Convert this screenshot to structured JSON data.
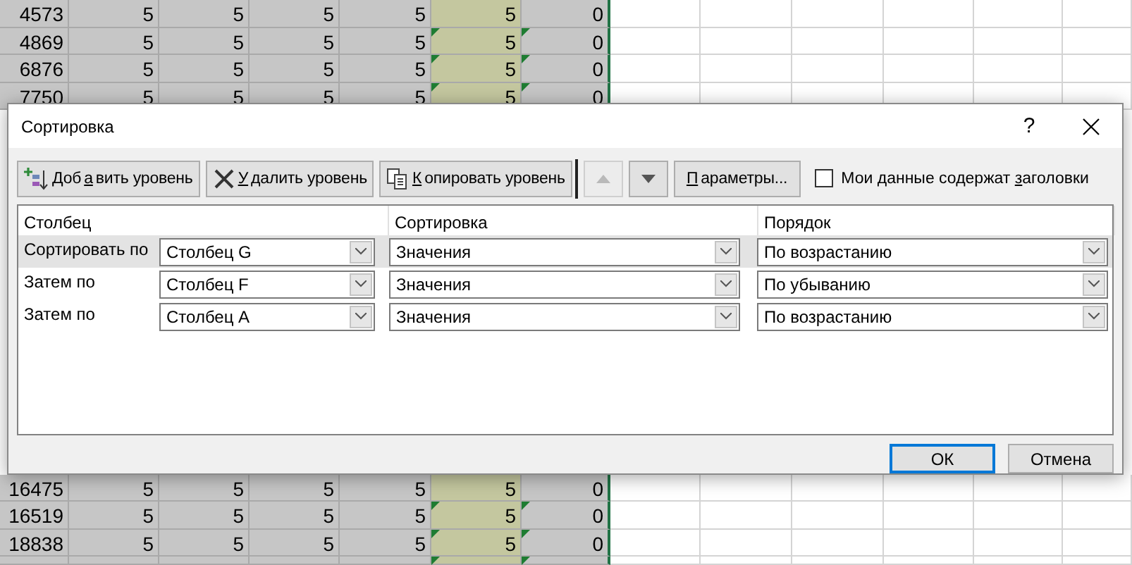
{
  "sheet": {
    "rows_top": [
      {
        "cells": [
          "4573",
          "5",
          "5",
          "5",
          "5",
          "5",
          "0"
        ],
        "flagged": false
      },
      {
        "cells": [
          "4869",
          "5",
          "5",
          "5",
          "5",
          "5",
          "0"
        ],
        "flagged": true
      },
      {
        "cells": [
          "6876",
          "5",
          "5",
          "5",
          "5",
          "5",
          "0"
        ],
        "flagged": true
      },
      {
        "cells": [
          "7750",
          "5",
          "5",
          "5",
          "5",
          "5",
          "0"
        ],
        "flagged": true
      }
    ],
    "rows_bottom": [
      {
        "cells": [
          "16475",
          "5",
          "5",
          "5",
          "5",
          "5",
          "0"
        ],
        "flagged": false
      },
      {
        "cells": [
          "16519",
          "5",
          "5",
          "5",
          "5",
          "5",
          "0"
        ],
        "flagged": true
      },
      {
        "cells": [
          "18838",
          "5",
          "5",
          "5",
          "5",
          "5",
          "0"
        ],
        "flagged": true
      },
      {
        "flagged": true
      }
    ]
  },
  "dialog": {
    "title": "Сортировка",
    "help": "?",
    "toolbar": [
      {
        "kind": "add",
        "label_parts": {
          "lead": "Доб",
          "key": "а",
          "rest": "вить уровень"
        },
        "disabled": false
      },
      {
        "kind": "delete",
        "label_parts": {
          "key": "У",
          "rest": "далить уровень"
        },
        "disabled": false
      },
      {
        "kind": "copy",
        "label_parts": {
          "key": "К",
          "rest": "опировать уровень"
        },
        "disabled": false
      },
      {
        "kind": "separator"
      },
      {
        "kind": "up",
        "disabled": true
      },
      {
        "kind": "down",
        "disabled": false
      },
      {
        "kind": "text",
        "label_parts": {
          "key": "П",
          "rest": "араметры..."
        },
        "disabled": false
      }
    ],
    "headers_checkbox": {
      "label_parts": {
        "lead": "Мои данные содержат ",
        "key": "з",
        "rest": "аголовки"
      },
      "checked": false
    },
    "columns": [
      "Столбец",
      "Сортировка",
      "Порядок"
    ],
    "levels": [
      {
        "label": "Сортировать по",
        "column": "Столбец G",
        "sort_on": "Значения",
        "order": "По возрастанию",
        "selected": true
      },
      {
        "label": "Затем по",
        "column": "Столбец F",
        "sort_on": "Значения",
        "order": "По убыванию",
        "selected": false
      },
      {
        "label": "Затем по",
        "column": "Столбец A",
        "sort_on": "Значения",
        "order": "По возрастанию",
        "selected": false
      }
    ],
    "buttons": [
      {
        "label": "ОК",
        "default": true
      },
      {
        "label": "Отмена",
        "default": false
      }
    ]
  }
}
